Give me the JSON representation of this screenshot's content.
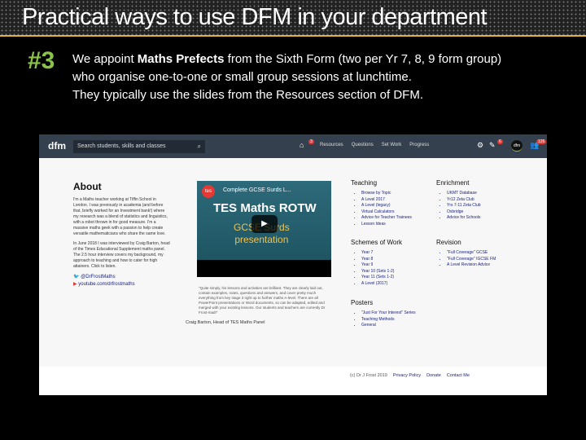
{
  "slide": {
    "title": "Practical ways to use DFM in your department",
    "number": "#3",
    "line1_pre": "We appoint ",
    "line1_bold": "Maths Prefects",
    "line1_post": " from the Sixth Form (two per Yr 7, 8, 9 form group)",
    "line2": "who organise one-to-one or small group sessions at lunchtime.",
    "line3": "They typically use the slides from the Resources section of DFM."
  },
  "nav": {
    "logo": "dfm",
    "search_placeholder": "Search students, skills and classes",
    "links": [
      "Resources",
      "Questions",
      "Set Work",
      "Progress"
    ],
    "home_badge": "3",
    "edit_badge": "6",
    "users_badge": "126",
    "avatar": "dfm"
  },
  "about": {
    "title": "About",
    "p1": "I'm a Maths teacher working at Tiffin School in London. I was previously in academia (and before that, briefly worked for an Investment bank!) where my research was a blend of statistics and linguistics, with a robot thrown in for good measure. I'm a massive maths geek with a passion to help create versatile mathematicians who share the same love.",
    "p2": "In June 2018 I was interviewed by Craig Barton, head of the Times Educational Supplement maths panel. The 2.5 hour interview covers my background, my approach to teaching and how to cater for high attainers. Click to listen.",
    "twitter": "@DrFrostMaths",
    "youtube": "youtube.com/drfrostmaths"
  },
  "video": {
    "channel": "tes",
    "title": "Complete GCSE Surds L...",
    "headline": "TES Maths ROTW",
    "sub1": "GCSE Surds",
    "sub2": "presentation"
  },
  "quote": "\"Quite simply, his lessons and activities are brilliant. They are clearly laid out, contain examples, notes, questions and answers, and cover pretty much everything from key stage 3 right up to further maths A-level. There are all PowerPoint presentations or Word documents, so can be adapted, edited and merged with your existing lessons. Our students and teachers are currently Dr Frost-mad!\"",
  "cite": "Craig Barton, Head of TES Maths Panel",
  "teaching": {
    "title": "Teaching",
    "items": [
      "Browse by Topic",
      "A Level 2017",
      "A Level (legacy)",
      "Virtual Calculators",
      "Advice for Teacher Trainees",
      "Lesson Ideas"
    ]
  },
  "enrichment": {
    "title": "Enrichment",
    "items": [
      "UKMT Database",
      "Yr12 Zeta Club",
      "Yrs 7-11 Zeta Club",
      "Oxbridge",
      "Advice for Schools"
    ]
  },
  "schemes": {
    "title": "Schemes of Work",
    "items": [
      "Year 7",
      "Year 8",
      "Year 9",
      "Year 10 (Sets 1-2)",
      "Year 11 (Sets 1-2)",
      "A Level (2017)"
    ]
  },
  "revision": {
    "title": "Revision",
    "items": [
      "\"Full Coverage\" GCSE",
      "\"Full Coverage\" IGCSE FM",
      "A Level Revision Advice"
    ]
  },
  "posters": {
    "title": "Posters",
    "items": [
      "\"Just For Your Interest\" Series",
      "Teaching Methods",
      "General"
    ]
  },
  "footer": {
    "copyright": "(c) Dr J Frost 2019",
    "links": [
      "Privacy Policy",
      "Donate",
      "Contact Me"
    ]
  }
}
